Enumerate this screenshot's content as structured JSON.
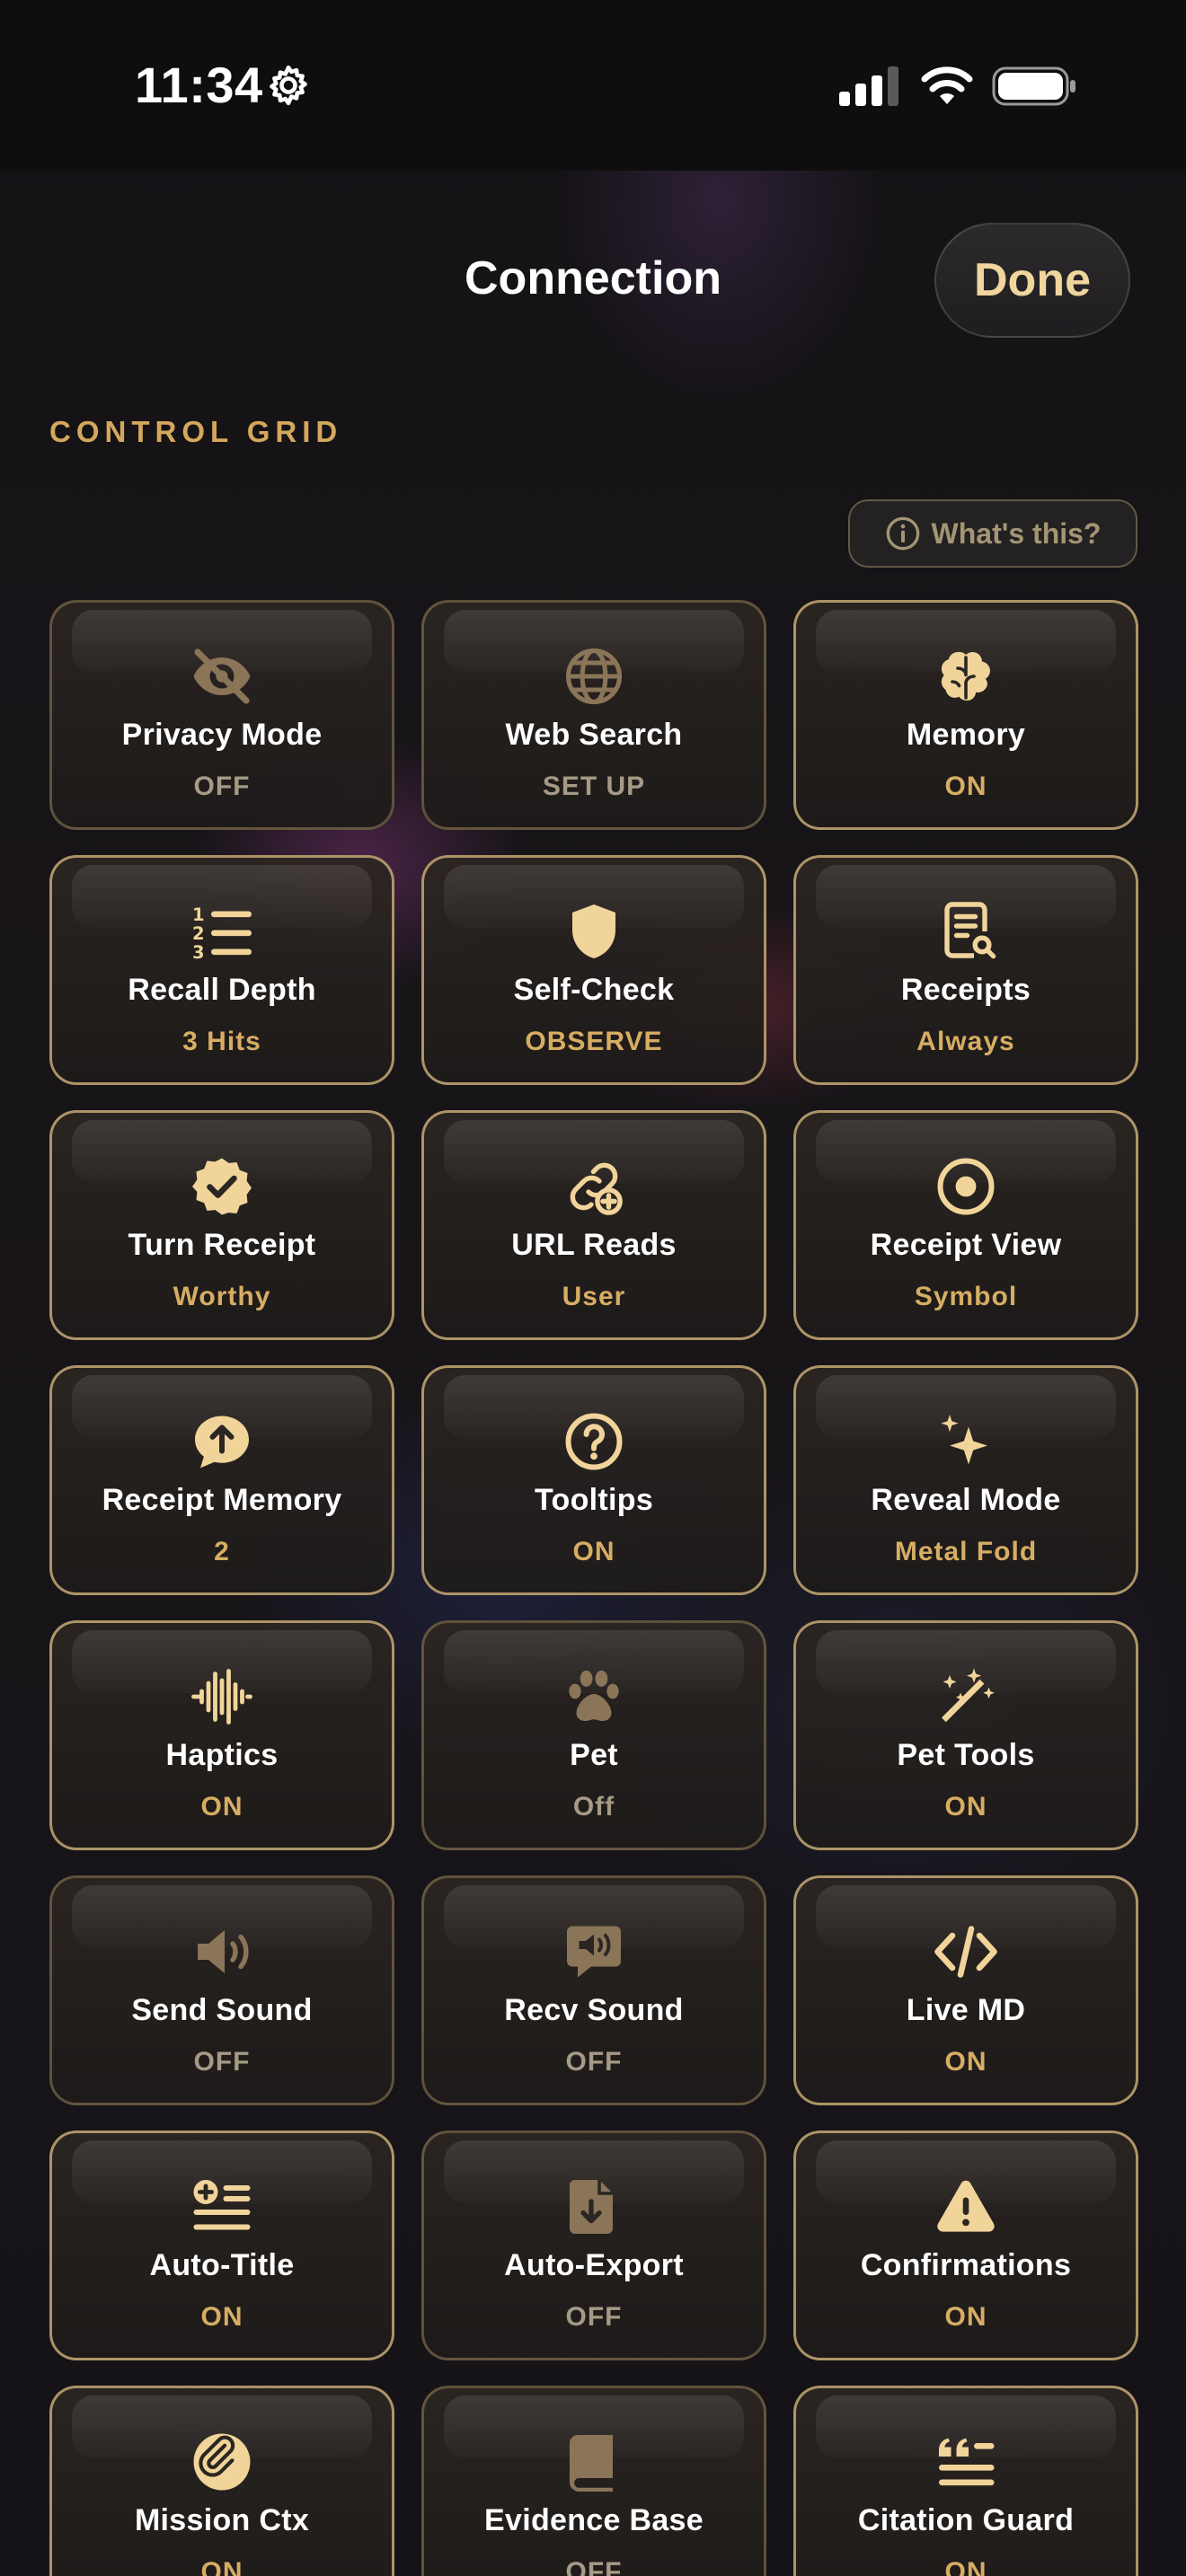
{
  "status_bar": {
    "time": "11:34"
  },
  "nav": {
    "title": "Connection",
    "done_label": "Done"
  },
  "section_header": "CONTROL GRID",
  "whats_this_label": "What's this?",
  "colors": {
    "accent": "#d6ad63",
    "icon_on": "#f1d49a",
    "icon_off": "#8b7558",
    "value_off": "#a69a86"
  },
  "tiles": [
    {
      "label": "Privacy Mode",
      "value": "OFF",
      "state": "off",
      "icon": "eye-slash-icon"
    },
    {
      "label": "Web Search",
      "value": "SET UP",
      "state": "off",
      "icon": "globe-icon"
    },
    {
      "label": "Memory",
      "value": "ON",
      "state": "on",
      "icon": "brain-icon"
    },
    {
      "label": "Recall Depth",
      "value": "3 Hits",
      "state": "on",
      "icon": "numbered-list-icon"
    },
    {
      "label": "Self-Check",
      "value": "OBSERVE",
      "state": "on",
      "icon": "shield-icon"
    },
    {
      "label": "Receipts",
      "value": "Always",
      "state": "on",
      "icon": "receipt-search-icon"
    },
    {
      "label": "Turn Receipt",
      "value": "Worthy",
      "state": "on",
      "icon": "check-badge-icon"
    },
    {
      "label": "URL Reads",
      "value": "User",
      "state": "on",
      "icon": "link-plus-icon"
    },
    {
      "label": "Receipt View",
      "value": "Symbol",
      "state": "on",
      "icon": "target-circle-icon"
    },
    {
      "label": "Receipt Memory",
      "value": "2",
      "state": "on",
      "icon": "speech-bubble-up-arrow-icon"
    },
    {
      "label": "Tooltips",
      "value": "ON",
      "state": "on",
      "icon": "question-circle-icon"
    },
    {
      "label": "Reveal Mode",
      "value": "Metal Fold",
      "state": "on",
      "icon": "sparkles-icon"
    },
    {
      "label": "Haptics",
      "value": "ON",
      "state": "on",
      "icon": "waveform-icon"
    },
    {
      "label": "Pet",
      "value": "Off",
      "state": "off",
      "icon": "paw-icon"
    },
    {
      "label": "Pet Tools",
      "value": "ON",
      "state": "on",
      "icon": "magic-wand-icon"
    },
    {
      "label": "Send Sound",
      "value": "OFF",
      "state": "off",
      "icon": "speaker-icon"
    },
    {
      "label": "Recv Sound",
      "value": "OFF",
      "state": "off",
      "icon": "speaker-bubble-icon"
    },
    {
      "label": "Live MD",
      "value": "ON",
      "state": "on",
      "icon": "code-icon"
    },
    {
      "label": "Auto-Title",
      "value": "ON",
      "state": "on",
      "icon": "list-plus-icon"
    },
    {
      "label": "Auto-Export",
      "value": "OFF",
      "state": "off",
      "icon": "document-download-icon"
    },
    {
      "label": "Confirmations",
      "value": "ON",
      "state": "on",
      "icon": "warning-triangle-icon"
    },
    {
      "label": "Mission Ctx",
      "value": "ON",
      "state": "on",
      "icon": "paperclip-icon"
    },
    {
      "label": "Evidence Base",
      "value": "OFF",
      "state": "off",
      "icon": "book-icon"
    },
    {
      "label": "Citation Guard",
      "value": "ON",
      "state": "on",
      "icon": "quote-lines-icon"
    }
  ]
}
